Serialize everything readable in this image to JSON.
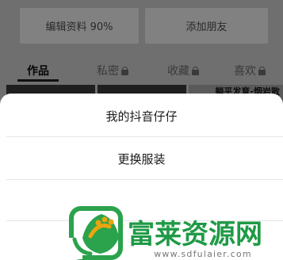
{
  "profile": {
    "edit_button_label": "编辑资料 90%",
    "add_friend_label": "添加朋友"
  },
  "tabs": [
    {
      "label": "作品",
      "active": true,
      "icon": null
    },
    {
      "label": "私密",
      "active": false,
      "icon": "lock-icon"
    },
    {
      "label": "收藏",
      "active": false,
      "icon": "lock-icon"
    },
    {
      "label": "喜欢",
      "active": false,
      "icon": "lock-icon"
    }
  ],
  "thumbnail_caption": "躺平发育-烟岩散",
  "action_sheet": {
    "items": [
      "我的抖音仔仔",
      "更换服装",
      ""
    ]
  },
  "watermark": {
    "title": "富莱资源网",
    "url": "www.sdfulaier.com"
  },
  "colors": {
    "overlay": "#6f6f6f",
    "sheet": "#ffffff",
    "watermark_green": "#2ba24c",
    "watermark_yellow": "#e9a50f"
  }
}
